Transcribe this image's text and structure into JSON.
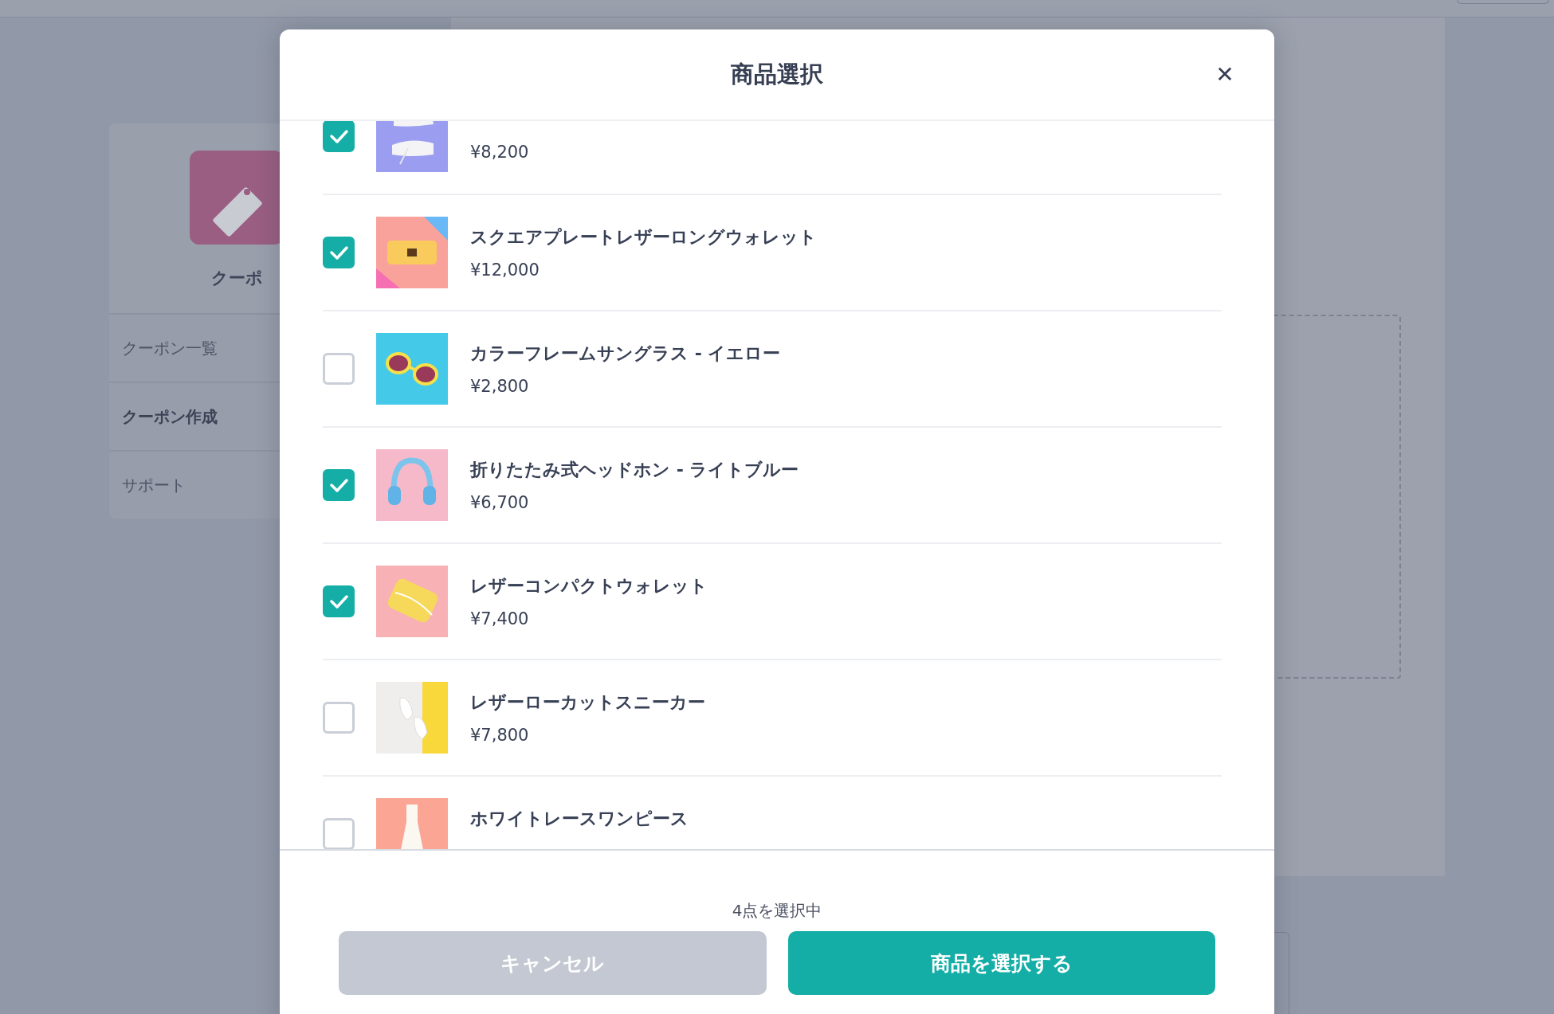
{
  "sidebar": {
    "title": "クーポ",
    "items": [
      {
        "label": "クーポン一覧",
        "selected": false
      },
      {
        "label": "クーポン作成",
        "selected": true
      },
      {
        "label": "サポート",
        "selected": false
      }
    ]
  },
  "modal": {
    "title": "商品選択",
    "close": "✕",
    "products": [
      {
        "price": "¥8,200",
        "checked": true
      },
      {
        "name": "スクエアプレートレザーロングウォレット",
        "price": "¥12,000",
        "checked": true
      },
      {
        "name": "カラーフレームサングラス - イエロー",
        "price": "¥2,800",
        "checked": false
      },
      {
        "name": "折りたたみ式ヘッドホン - ライトブルー",
        "price": "¥6,700",
        "checked": true
      },
      {
        "name": "レザーコンパクトウォレット",
        "price": "¥7,400",
        "checked": true
      },
      {
        "name": "レザーローカットスニーカー",
        "price": "¥7,800",
        "checked": false
      },
      {
        "name": "ホワイトレースワンピース",
        "checked": false
      }
    ],
    "selection_count": "4点を選択中",
    "buttons": [
      {
        "label": "キャンセル",
        "kind": "cancel"
      },
      {
        "label": "商品を選択する",
        "kind": "primary"
      }
    ]
  }
}
